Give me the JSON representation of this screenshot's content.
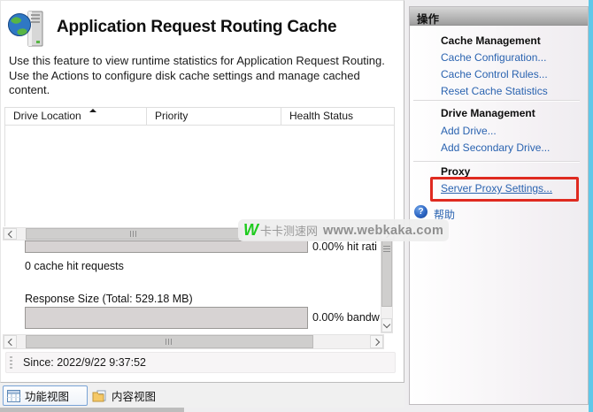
{
  "header": {
    "title": "Application Request Routing Cache",
    "description": "Use this feature to view runtime statistics for Application Request Routing.  Use the Actions to configure disk cache settings and manage cached content."
  },
  "table": {
    "columns": [
      "Drive Location",
      "Priority",
      "Health Status"
    ],
    "rows": []
  },
  "stats": {
    "hit_ratio_label": "0.00% hit rati",
    "cache_hits": "0 cache hit requests",
    "response_size": "Response Size (Total: 529.18 MB)",
    "bandwidth_label": "0.00% bandw",
    "since": "Since: 2022/9/22 9:37:52"
  },
  "actions": {
    "title": "操作",
    "groups": [
      {
        "heading": "Cache Management",
        "links": [
          "Cache Configuration...",
          "Cache Control Rules...",
          "Reset Cache Statistics"
        ]
      },
      {
        "heading": "Drive Management",
        "links": [
          "Add Drive...",
          "Add Secondary Drive..."
        ]
      },
      {
        "heading": "Proxy",
        "links": [
          "Server Proxy Settings..."
        ]
      }
    ],
    "help": "帮助"
  },
  "tabs": [
    {
      "label": "功能视图"
    },
    {
      "label": "内容视图"
    }
  ],
  "watermark": {
    "w": "W",
    "site": "卡卡测速网",
    "url": "www.webkaka.com"
  },
  "icons": {
    "page_icon": "globe-server",
    "sort_icon": "triangle-up",
    "help_icon": "question-circle",
    "features_view_icon": "table-grid",
    "content_view_icon": "folder",
    "scrollbar_icons": "chevron-left/right/down"
  },
  "colors": {
    "link_blue": "#2a63b0",
    "highlight_red": "#df2a20",
    "watermark_green": "#1ecb1e",
    "edge_cyan": "#5fc8e9",
    "actions_header_gray": "#a6a6a6"
  }
}
